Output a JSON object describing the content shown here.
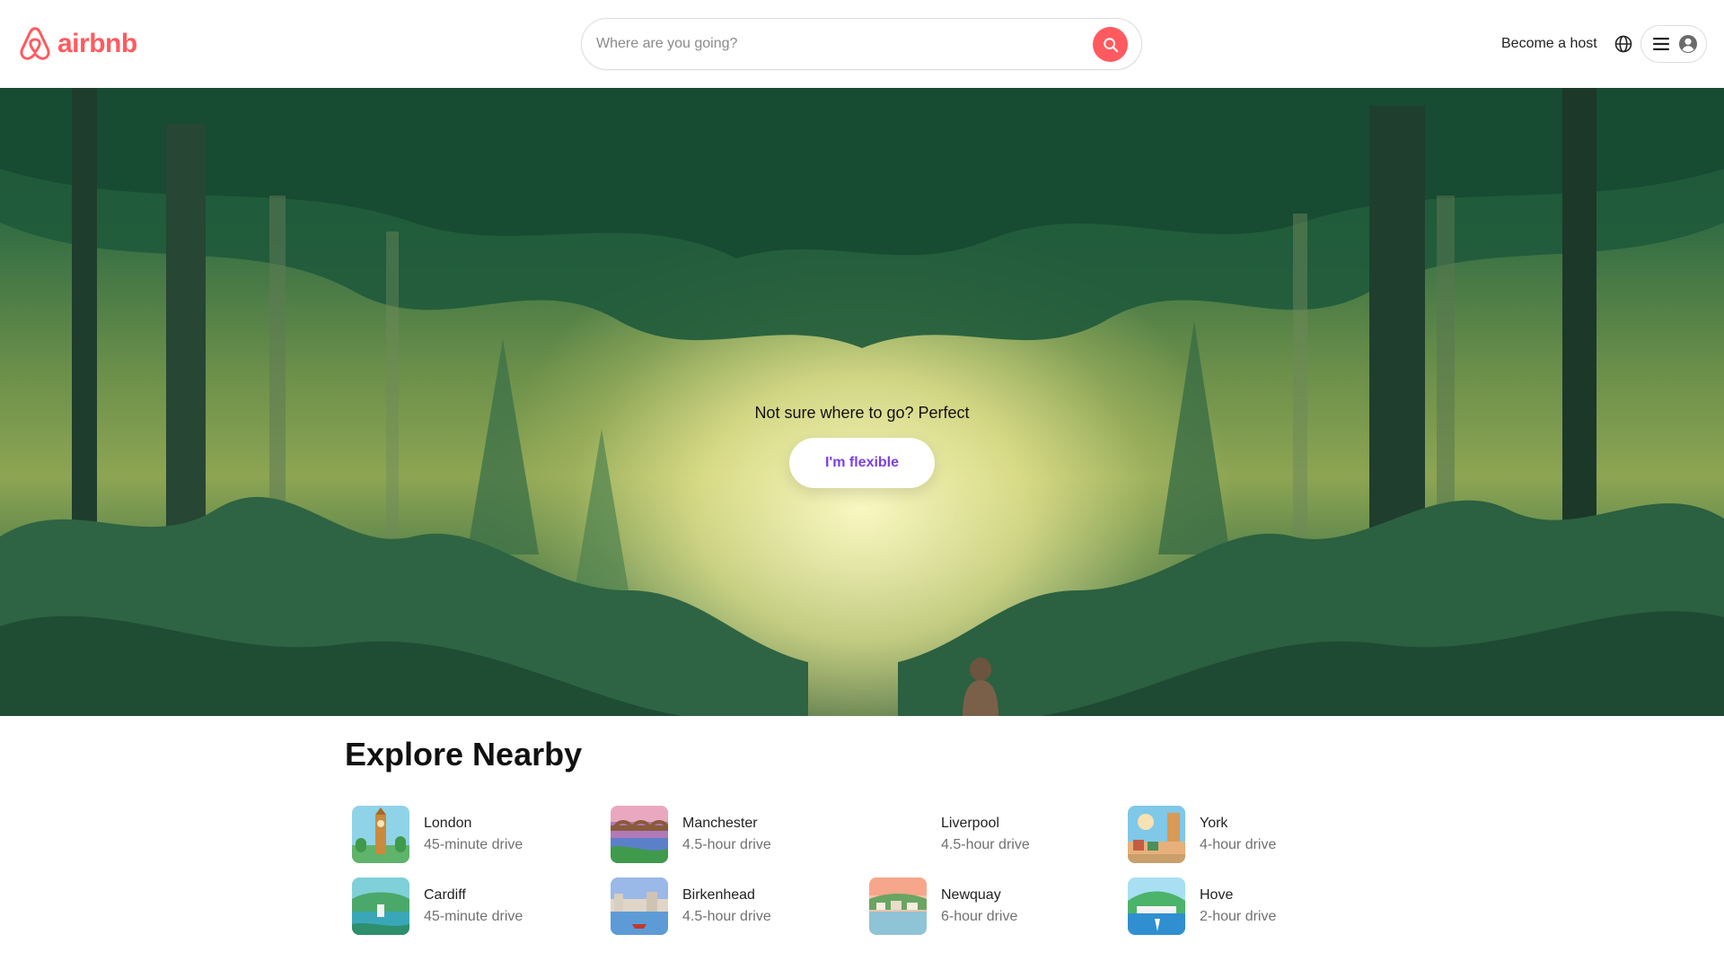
{
  "header": {
    "logo_text": "airbnb",
    "search": {
      "placeholder": "Where are you going?"
    },
    "become_host_label": "Become a host"
  },
  "hero": {
    "tagline": "Not sure where to go? Perfect",
    "cta_label": "I'm flexible"
  },
  "explore": {
    "title": "Explore Nearby",
    "items": [
      {
        "city": "London",
        "distance": "45-minute drive"
      },
      {
        "city": "Manchester",
        "distance": "4.5-hour drive"
      },
      {
        "city": "Liverpool",
        "distance": "4.5-hour drive"
      },
      {
        "city": "York",
        "distance": "4-hour drive"
      },
      {
        "city": "Cardiff",
        "distance": "45-minute drive"
      },
      {
        "city": "Birkenhead",
        "distance": "4.5-hour drive"
      },
      {
        "city": "Newquay",
        "distance": "6-hour drive"
      },
      {
        "city": "Hove",
        "distance": "2-hour drive"
      }
    ]
  },
  "colors": {
    "brand": "#ff5a5f",
    "cta_text": "#7b3fe4",
    "secondary_text": "#717171"
  },
  "icons": [
    "airbnb-logo-icon",
    "search-icon",
    "globe-icon",
    "menu-icon",
    "user-icon"
  ]
}
